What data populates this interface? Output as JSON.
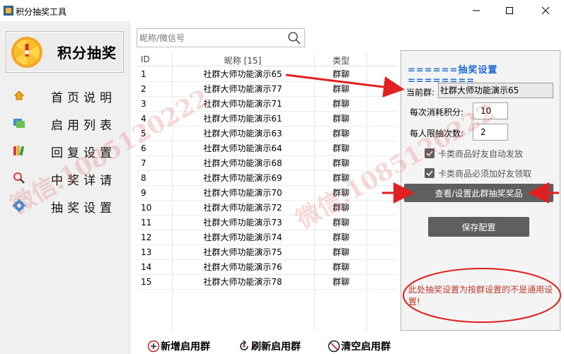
{
  "window": {
    "title": "积分抽奖工具"
  },
  "sidebar": {
    "logo_text": "积分抽奖",
    "items": [
      {
        "label": "首页说明",
        "icon": "home-icon"
      },
      {
        "label": "启用列表",
        "icon": "list-icon"
      },
      {
        "label": "回复设置",
        "icon": "books-icon"
      },
      {
        "label": "中奖详请",
        "icon": "search-icon"
      },
      {
        "label": "抽奖设置",
        "icon": "gear-icon"
      }
    ]
  },
  "search": {
    "placeholder": "昵称/微信号"
  },
  "table": {
    "headers": {
      "id": "ID",
      "nickname": "昵称 [15]",
      "type": "类型"
    },
    "rows": [
      {
        "id": "1",
        "nickname": "社群大师功能演示65",
        "type": "群聊"
      },
      {
        "id": "2",
        "nickname": "社群大师功能演示77",
        "type": "群聊"
      },
      {
        "id": "3",
        "nickname": "社群大师功能演示71",
        "type": "群聊"
      },
      {
        "id": "4",
        "nickname": "社群大师功能演示61",
        "type": "群聊"
      },
      {
        "id": "5",
        "nickname": "社群大师功能演示63",
        "type": "群聊"
      },
      {
        "id": "6",
        "nickname": "社群大师功能演示64",
        "type": "群聊"
      },
      {
        "id": "7",
        "nickname": "社群大师功能演示68",
        "type": "群聊"
      },
      {
        "id": "8",
        "nickname": "社群大师功能演示69",
        "type": "群聊"
      },
      {
        "id": "9",
        "nickname": "社群大师功能演示70",
        "type": "群聊"
      },
      {
        "id": "10",
        "nickname": "社群大师功能演示72",
        "type": "群聊"
      },
      {
        "id": "11",
        "nickname": "社群大师功能演示73",
        "type": "群聊"
      },
      {
        "id": "12",
        "nickname": "社群大师功能演示74",
        "type": "群聊"
      },
      {
        "id": "13",
        "nickname": "社群大师功能演示75",
        "type": "群聊"
      },
      {
        "id": "14",
        "nickname": "社群大师功能演示76",
        "type": "群聊"
      },
      {
        "id": "15",
        "nickname": "社群大师功能演示78",
        "type": "群聊"
      }
    ]
  },
  "bottom_actions": {
    "add": "新增启用群",
    "refresh": "刷新启用群",
    "clear": "清空启用群"
  },
  "settings": {
    "title": "======抽奖设置========",
    "current_group_label": "当前群:",
    "current_group_value": "社群大师功能演示65",
    "cost_label": "每次消耗积分:",
    "cost_value": "10",
    "limit_label": "每人限抽次数:",
    "limit_value": "2",
    "check1_label": "卡类商品好友自动发放",
    "check1_checked": true,
    "check2_label": "卡类商品必须加好友领取",
    "check2_checked": true,
    "view_prizes_button": "查看/设置此群抽奖奖品",
    "save_button": "保存配置",
    "note": "此处抽奖设置为按群设置的不是通用设置!"
  },
  "watermarks": [
    "微信:1085120222",
    "微信:1085120222"
  ],
  "colors": {
    "accent_blue": "#1e6bd6",
    "annotation_red": "#e02020",
    "button_dark": "#5f5f5f"
  }
}
